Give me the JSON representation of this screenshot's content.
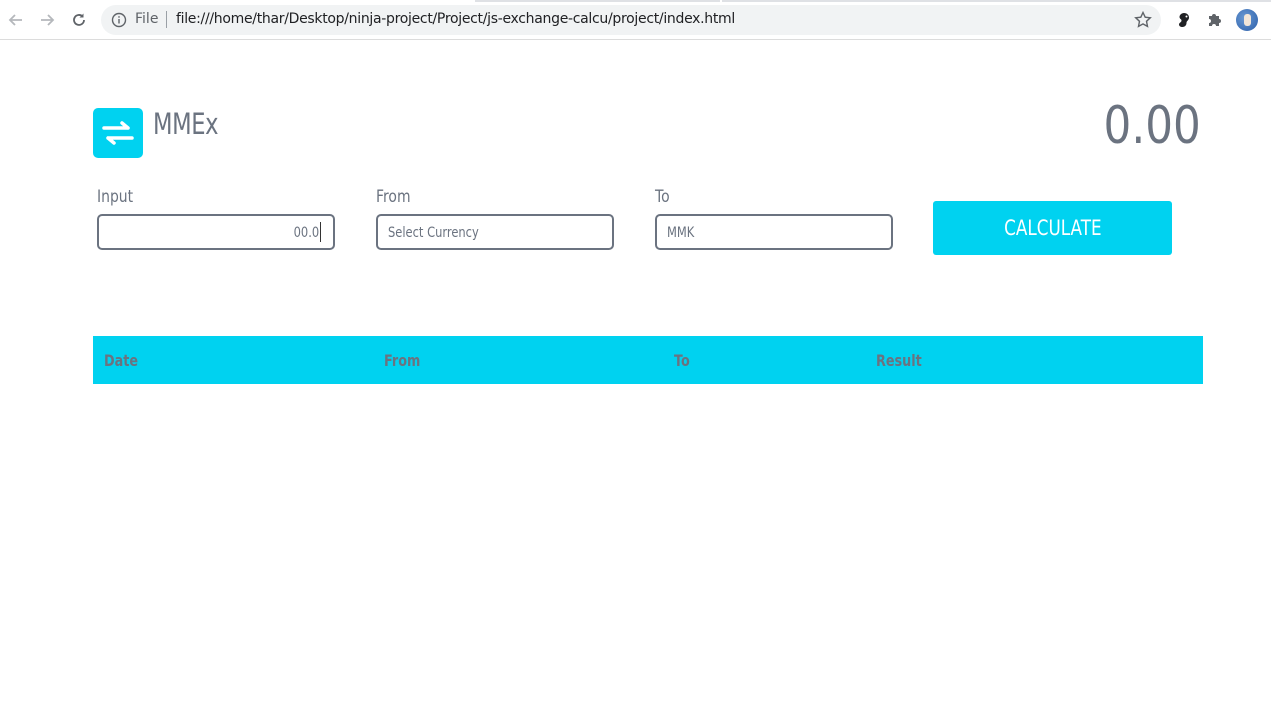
{
  "browser": {
    "scheme_label": "File",
    "url": "file:///home/thar/Desktop/ninja-project/Project/js-exchange-calcu/project/index.html"
  },
  "app": {
    "brand": "MMEx",
    "total": "0.00",
    "accent_color": "#00d2f0",
    "text_color": "#6b7380"
  },
  "form": {
    "input_label": "Input",
    "input_value": "00.0",
    "from_label": "From",
    "from_value": "Select Currency",
    "to_label": "To",
    "to_value": "MMK",
    "calculate_label": "CALCULATE"
  },
  "history": {
    "columns": [
      "Date",
      "From",
      "To",
      "Result"
    ]
  }
}
